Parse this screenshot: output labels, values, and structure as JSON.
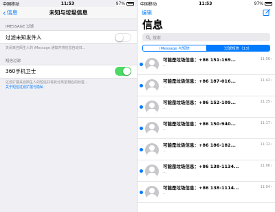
{
  "left": {
    "status": {
      "carrier": "中国移动",
      "time": "11:53",
      "battery": "97%"
    },
    "nav": {
      "back_label": "信息",
      "title": "未知与垃圾信息"
    },
    "imessage_section": {
      "header": "IMESSAGE 过滤",
      "filter_label": "过滤未知发件人",
      "filter_on": false,
      "note": "关闭来自陌生人的 iMessage 通知并将信息自动归..."
    },
    "sms_section": {
      "header": "短信过滤",
      "app_label": "360手机卫士",
      "app_on": true,
      "note": "过滤扩展来自陌生人的短信并将其分类至相应的标签...",
      "link": "关于短信过滤扩展与隐私"
    }
  },
  "right": {
    "status": {
      "carrier": "中国移动",
      "time": "11:53",
      "battery": "97%"
    },
    "edit_label": "编辑",
    "compose_icon": "compose-icon",
    "title": "信息",
    "search_placeholder": "搜索",
    "segments": [
      "iMessage 与短信",
      "过滤短信（13）"
    ],
    "messages": [
      {
        "sender": "可能是垃圾信息：+86 151-169...",
        "time": "11:56",
        "preview": "…"
      },
      {
        "sender": "可能是垃圾信息：+86 187-016...",
        "time": "11:42",
        "preview": "…"
      },
      {
        "sender": "可能是垃圾信息：+86 152-109...",
        "time": "11:25",
        "preview": "…"
      },
      {
        "sender": "可能是垃圾信息：+86 150-940...",
        "time": "11:17",
        "preview": "…"
      },
      {
        "sender": "可能是垃圾信息：+86 186-182...",
        "time": "11:12",
        "preview": "…"
      },
      {
        "sender": "可能是垃圾信息：+86 138-1134...",
        "time": "11:06",
        "preview": "…"
      },
      {
        "sender": "可能是垃圾信息：+86 138-1114...",
        "time": "11:04",
        "preview": "…"
      }
    ]
  }
}
